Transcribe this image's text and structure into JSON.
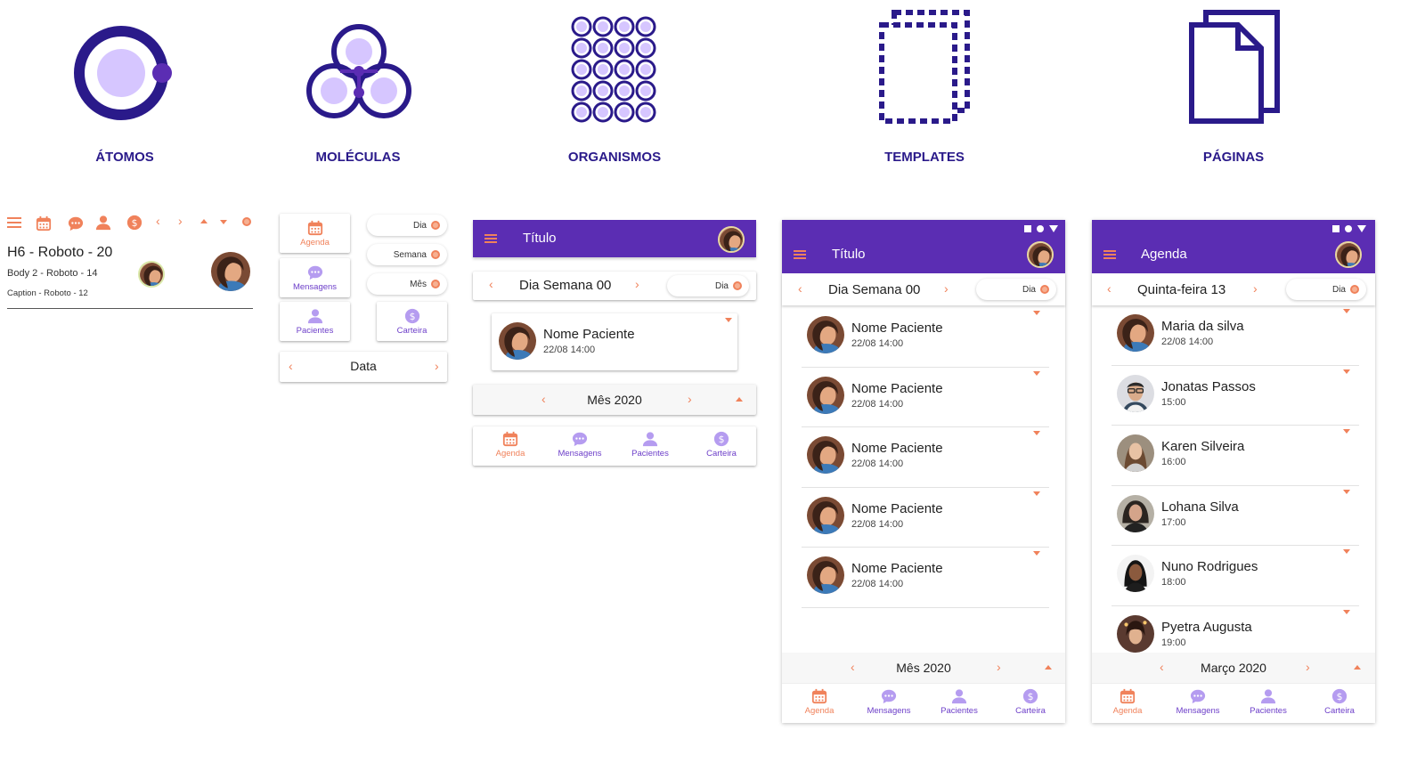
{
  "categories": [
    {
      "label": "ÁTOMOS",
      "icon": "atom-icon"
    },
    {
      "label": "MOLÉCULAS",
      "icon": "molecule-icon"
    },
    {
      "label": "ORGANISMOS",
      "icon": "organism-icon"
    },
    {
      "label": "TEMPLATES",
      "icon": "template-icon"
    },
    {
      "label": "PÁGINAS",
      "icon": "pages-icon"
    }
  ],
  "atoms": {
    "h6": "H6 - Roboto - 20",
    "body2": "Body 2 - Roboto - 14",
    "caption": "Caption - Roboto - 12"
  },
  "molecules": {
    "nav": {
      "agenda": "Agenda",
      "mensagens": "Mensagens",
      "pacientes": "Pacientes",
      "carteira": "Carteira"
    },
    "pills": {
      "dia": "Dia",
      "semana": "Semana",
      "mes": "Mês"
    },
    "date_label": "Data"
  },
  "organisms": {
    "title": "Título",
    "day": "Dia Semana 00",
    "pill": "Dia",
    "patient_name": "Nome Paciente",
    "patient_time": "22/08 14:00",
    "month": "Mês 2020",
    "nav": {
      "agenda": "Agenda",
      "mensagens": "Mensagens",
      "pacientes": "Pacientes",
      "carteira": "Carteira"
    }
  },
  "template": {
    "title": "Título",
    "day": "Dia Semana 00",
    "pill": "Dia",
    "rows": [
      {
        "name": "Nome Paciente",
        "time": "22/08 14:00"
      },
      {
        "name": "Nome Paciente",
        "time": "22/08 14:00"
      },
      {
        "name": "Nome Paciente",
        "time": "22/08 14:00"
      },
      {
        "name": "Nome Paciente",
        "time": "22/08 14:00"
      },
      {
        "name": "Nome Paciente",
        "time": "22/08 14:00"
      }
    ],
    "month": "Mês 2020",
    "nav": {
      "agenda": "Agenda",
      "mensagens": "Mensagens",
      "pacientes": "Pacientes",
      "carteira": "Carteira"
    }
  },
  "page": {
    "title": "Agenda",
    "day": "Quinta-feira 13",
    "pill": "Dia",
    "rows": [
      {
        "name": "Maria da silva",
        "time": "22/08 14:00"
      },
      {
        "name": "Jonatas Passos",
        "time": "15:00"
      },
      {
        "name": "Karen Silveira",
        "time": "16:00"
      },
      {
        "name": "Lohana Silva",
        "time": "17:00"
      },
      {
        "name": "Nuno Rodrigues",
        "time": "18:00"
      },
      {
        "name": "Pyetra Augusta",
        "time": "19:00"
      }
    ],
    "month": "Março 2020",
    "nav": {
      "agenda": "Agenda",
      "mensagens": "Mensagens",
      "pacientes": "Pacientes",
      "carteira": "Carteira"
    }
  },
  "colors": {
    "primary": "#5b2db3",
    "accent": "#f0825b",
    "nav_inactive": "#6d3fc9",
    "icon_dark": "#2a1a8a",
    "icon_light": "#d6c6ff"
  }
}
